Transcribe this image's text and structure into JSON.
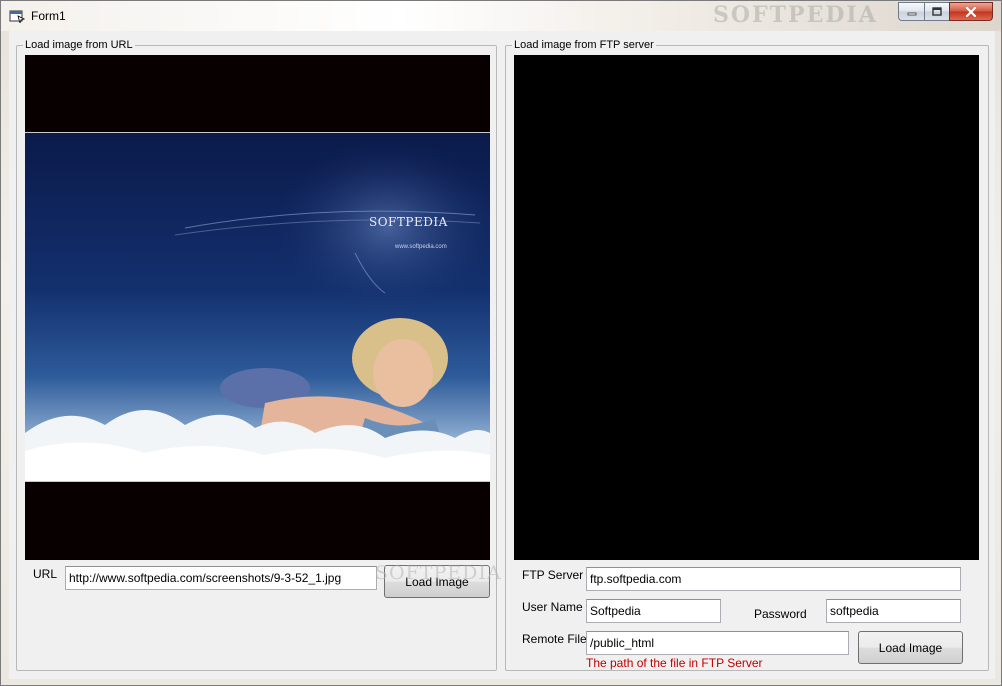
{
  "window": {
    "title": "Form1",
    "watermark": "SOFTPEDIA"
  },
  "url_group": {
    "label": "Load image from URL",
    "image_watermark": "SOFTPEDIA",
    "image_website": "www.softpedia.com",
    "url_label": "URL",
    "url_value": "http://www.softpedia.com/screenshots/9-3-52_1.jpg",
    "load_button": "Load Image",
    "mid_watermark": "SOFTPEDIA"
  },
  "ftp_group": {
    "label": "Load image from FTP server",
    "server_label": "FTP Server",
    "server_value": "ftp.softpedia.com",
    "user_label": "User Name",
    "user_value": "Softpedia",
    "password_label": "Password",
    "password_value": "softpedia",
    "remote_label": "Remote File",
    "remote_value": "/public_html",
    "remote_hint": "The path of the file in FTP Server",
    "load_button": "Load Image"
  },
  "colors": {
    "hint_text": "#c00000",
    "image_background": "#000000"
  }
}
